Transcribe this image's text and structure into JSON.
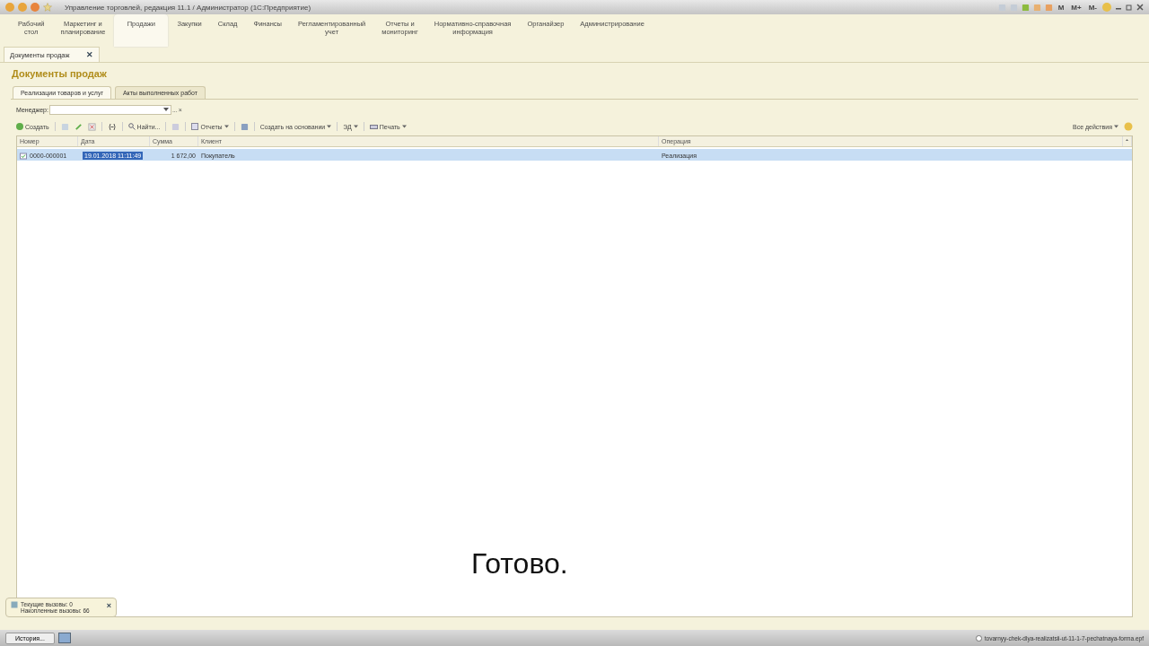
{
  "window": {
    "title": "Управление торговлей, редакция 11.1 / Администратор  (1С:Предприятие)",
    "controls": [
      "M",
      "M+",
      "M-"
    ]
  },
  "sections": [
    {
      "label": "Рабочий\nстол",
      "selected": false
    },
    {
      "label": "Маркетинг и\nпланирование",
      "selected": false
    },
    {
      "label": "Продажи",
      "selected": true
    },
    {
      "label": "Закупки",
      "selected": false
    },
    {
      "label": "Склад",
      "selected": false
    },
    {
      "label": "Финансы",
      "selected": false
    },
    {
      "label": "Регламентированный\nучет",
      "selected": false
    },
    {
      "label": "Отчеты и\nмониторинг",
      "selected": false
    },
    {
      "label": "Нормативно-справочная\nинформация",
      "selected": false
    },
    {
      "label": "Органайзер",
      "selected": false
    },
    {
      "label": "Администрирование",
      "selected": false
    }
  ],
  "open_tabs": [
    {
      "label": "Документы продаж",
      "close": "✕"
    }
  ],
  "form": {
    "title": "Документы продаж",
    "tabs": [
      {
        "label": "Реализации товаров и услуг",
        "selected": true
      },
      {
        "label": "Акты выполненных работ",
        "selected": false
      }
    ],
    "manager": {
      "label": "Менеджер:",
      "dots": "...",
      "clear": "×"
    },
    "toolbar": {
      "create": "Создать",
      "find": "Найти...",
      "reports": "Отчеты",
      "create_based": "Создать на основании",
      "ed": "ЭД",
      "print": "Печать",
      "all_actions": "Все действия"
    },
    "table": {
      "columns": [
        "Номер",
        "Дата",
        "Сумма",
        "Клиент",
        "Операция"
      ],
      "rows": [
        {
          "cells": [
            "0000-000001",
            "19.01.2018 11:11:49",
            "1 672,00",
            "Покупатель",
            "Реализация"
          ],
          "selected": true
        }
      ]
    }
  },
  "subtitle": "Готово.",
  "calls_panel": {
    "lines": [
      "Текущие вызовы: 0",
      "Накопленные вызовы: 66"
    ],
    "close": "×"
  },
  "taskbar": {
    "history": "История...",
    "file": "tovarnyy-chek-dlya-realizatsii-ut-11-1-7-pechatnaya-forma.epf"
  }
}
